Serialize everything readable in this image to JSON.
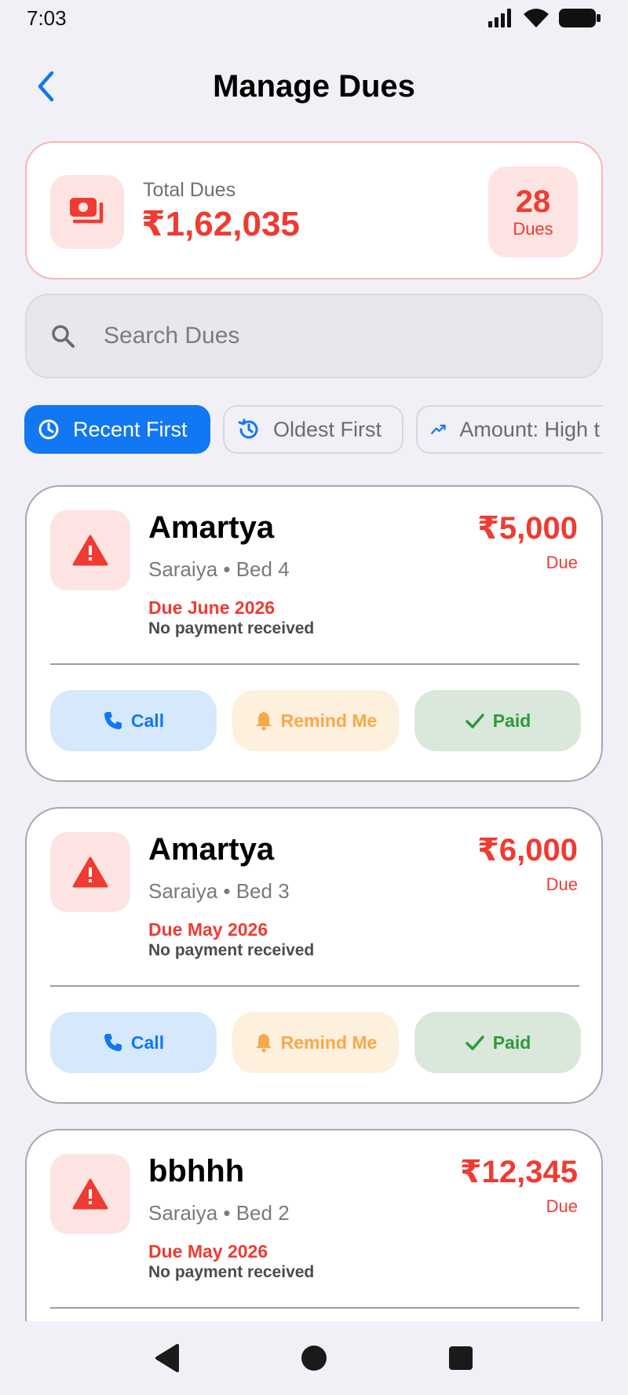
{
  "status_bar": {
    "time": "7:03"
  },
  "header": {
    "title": "Manage Dues"
  },
  "summary": {
    "label": "Total Dues",
    "amount": "₹1,62,035",
    "count": "28",
    "count_label": "Dues"
  },
  "search": {
    "placeholder": "Search Dues"
  },
  "filters": [
    {
      "label": "Recent First",
      "icon": "clock-icon",
      "active": true
    },
    {
      "label": "Oldest First",
      "icon": "history-icon",
      "active": false
    },
    {
      "label": "Amount: High t",
      "icon": "trending-up-icon",
      "active": false
    }
  ],
  "dues": [
    {
      "name": "Amartya",
      "location": "Saraiya",
      "bed": "Bed 4",
      "due_date": "Due June 2026",
      "status": "No payment received",
      "amount": "₹5,000",
      "amount_label": "Due"
    },
    {
      "name": "Amartya",
      "location": "Saraiya",
      "bed": "Bed 3",
      "due_date": "Due May 2026",
      "status": "No payment received",
      "amount": "₹6,000",
      "amount_label": "Due"
    },
    {
      "name": "bbhhh",
      "location": "Saraiya",
      "bed": "Bed 2",
      "due_date": "Due May 2026",
      "status": "No payment received",
      "amount": "₹12,345",
      "amount_label": "Due"
    }
  ],
  "actions": {
    "call": "Call",
    "remind": "Remind Me",
    "paid": "Paid"
  },
  "colors": {
    "accent": "#1177f2",
    "danger": "#ef3b32",
    "warning": "#f7a94a",
    "success": "#2f9a3c",
    "background": "#f1f0f6"
  }
}
